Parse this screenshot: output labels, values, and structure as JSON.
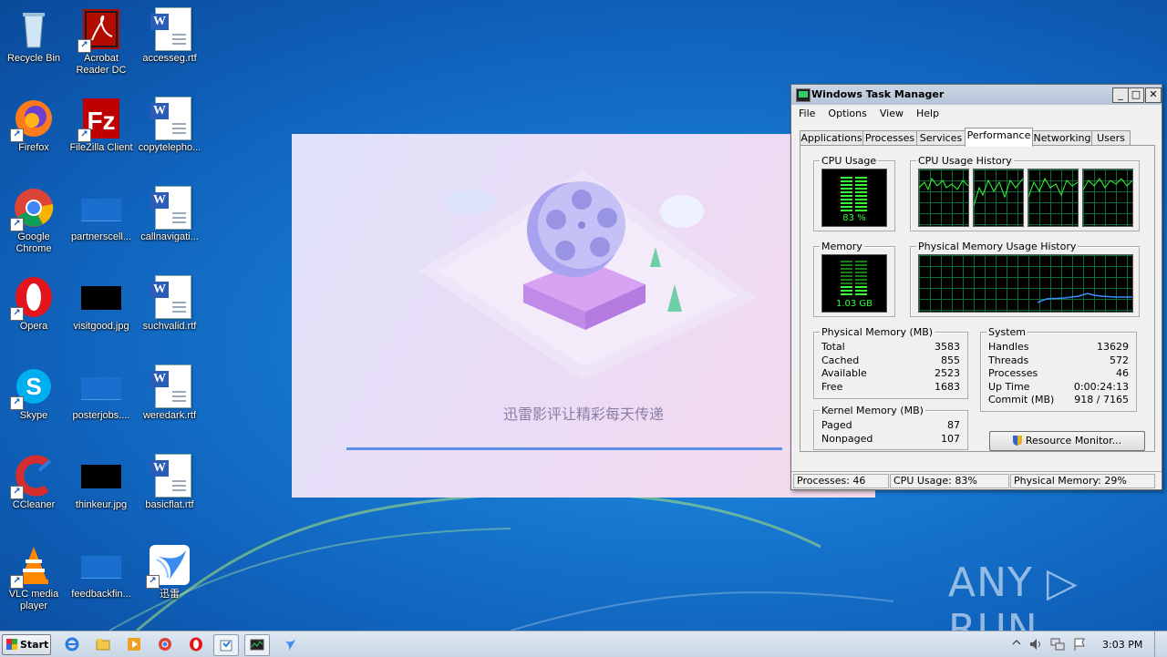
{
  "desktop": {
    "icons": [
      {
        "label": "Recycle Bin"
      },
      {
        "label": "Acrobat Reader DC"
      },
      {
        "label": "accesseg.rtf"
      },
      {
        "label": "Firefox"
      },
      {
        "label": "FileZilla Client"
      },
      {
        "label": "copytelepho..."
      },
      {
        "label": "Google Chrome"
      },
      {
        "label": "partnerscell..."
      },
      {
        "label": "callnavigati..."
      },
      {
        "label": "Opera"
      },
      {
        "label": "visitgood.jpg"
      },
      {
        "label": "suchvalid.rtf"
      },
      {
        "label": "Skype"
      },
      {
        "label": "posterjobs...."
      },
      {
        "label": "weredark.rtf"
      },
      {
        "label": "CCleaner"
      },
      {
        "label": "thinkeur.jpg"
      },
      {
        "label": "basicflat.rtf"
      },
      {
        "label": "VLC media player"
      },
      {
        "label": "feedbackfin..."
      },
      {
        "label": "迅雷"
      }
    ]
  },
  "splash": {
    "tagline": "迅雷影评让精彩每天传递",
    "progress": 0.92
  },
  "task_manager": {
    "title": "Windows Task Manager",
    "window_buttons": {
      "minimize": "_",
      "maximize": "□",
      "close": "✕"
    },
    "menu": [
      "File",
      "Options",
      "View",
      "Help"
    ],
    "tabs": [
      "Applications",
      "Processes",
      "Services",
      "Performance",
      "Networking",
      "Users"
    ],
    "active_tab": "Performance",
    "cpu_usage": {
      "title": "CPU Usage",
      "value": "83 %"
    },
    "cpu_history": {
      "title": "CPU Usage History"
    },
    "memory": {
      "title": "Memory",
      "value": "1.03 GB"
    },
    "memory_history": {
      "title": "Physical Memory Usage History"
    },
    "physical_memory": {
      "title": "Physical Memory (MB)",
      "rows": [
        {
          "k": "Total",
          "v": "3583"
        },
        {
          "k": "Cached",
          "v": "855"
        },
        {
          "k": "Available",
          "v": "2523"
        },
        {
          "k": "Free",
          "v": "1683"
        }
      ]
    },
    "kernel_memory": {
      "title": "Kernel Memory (MB)",
      "rows": [
        {
          "k": "Paged",
          "v": "87"
        },
        {
          "k": "Nonpaged",
          "v": "107"
        }
      ]
    },
    "system": {
      "title": "System",
      "rows": [
        {
          "k": "Handles",
          "v": "13629"
        },
        {
          "k": "Threads",
          "v": "572"
        },
        {
          "k": "Processes",
          "v": "46"
        },
        {
          "k": "Up Time",
          "v": "0:00:24:13"
        },
        {
          "k": "Commit (MB)",
          "v": "918 / 7165"
        }
      ]
    },
    "resource_monitor_button": "Resource Monitor...",
    "status": {
      "processes": "Processes: 46",
      "cpu": "CPU Usage: 83%",
      "memory": "Physical Memory: 29%"
    }
  },
  "taskbar": {
    "start_label": "Start",
    "clock": "3:03 PM"
  },
  "watermark": "ANY ▷ RUN"
}
